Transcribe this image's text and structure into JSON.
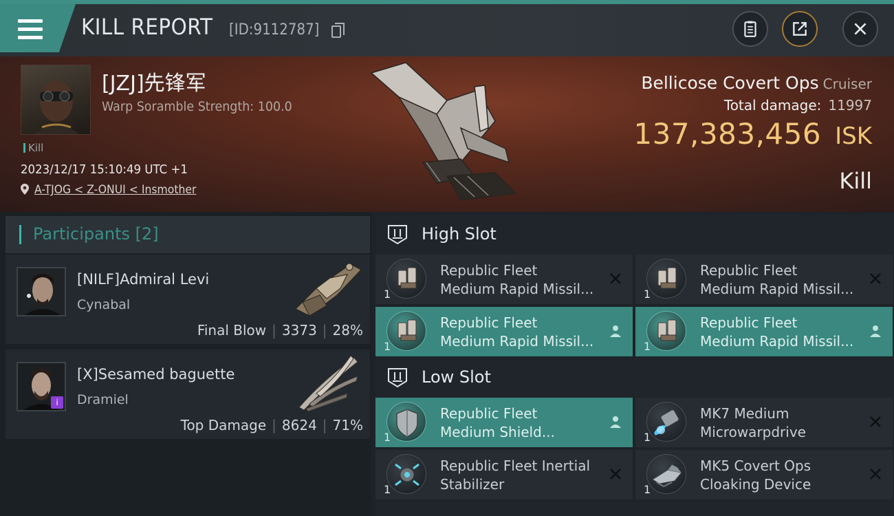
{
  "header": {
    "title": "KILL REPORT",
    "report_id": "[ID:9112787]",
    "buttons": [
      "clipboard-icon",
      "share-icon",
      "close-icon"
    ]
  },
  "victim": {
    "name": "[JZJ]先锋军",
    "warp_text": "Warp Soramble Strength: 100.0",
    "tag": "Kill",
    "timestamp": "2023/12/17 15:10:49 UTC +1",
    "location": "A-TJOG < Z-ONUI < Insmother",
    "ship_name": "Bellicose Covert Ops",
    "ship_class": "Cruiser",
    "damage_label": "Total damage:",
    "damage_value": "11997",
    "isk_amount": "137,383,456",
    "isk_currency": "ISK",
    "kill_type": "Kill"
  },
  "participants": {
    "label": "Participants [2]",
    "rows": [
      {
        "name": "[NILF]Admiral Levi",
        "ship": "Cynabal",
        "role": "Final Blow",
        "damage": "3373",
        "percent": "28%"
      },
      {
        "name": "[X]Sesamed baguette",
        "ship": "Dramiel",
        "role": "Top Damage",
        "damage": "8624",
        "percent": "71%"
      }
    ]
  },
  "slots": {
    "high": {
      "label": "High Slot",
      "modules": [
        {
          "line1": "Republic Fleet",
          "line2": "Medium Rapid Missil...",
          "qty": "1",
          "status": "destroyed"
        },
        {
          "line1": "Republic Fleet",
          "line2": "Medium Rapid Missil...",
          "qty": "1",
          "status": "destroyed"
        },
        {
          "line1": "Republic Fleet",
          "line2": "Medium Rapid Missil...",
          "qty": "1",
          "status": "dropped"
        },
        {
          "line1": "Republic Fleet",
          "line2": "Medium Rapid Missil...",
          "qty": "1",
          "status": "dropped"
        }
      ]
    },
    "low": {
      "label": "Low Slot",
      "modules": [
        {
          "line1": "Republic Fleet",
          "line2": "Medium Shield...",
          "qty": "1",
          "status": "dropped"
        },
        {
          "line1": "MK7 Medium",
          "line2": "Microwarpdrive",
          "qty": "1",
          "status": "destroyed"
        },
        {
          "line1": "Republic Fleet Inertial",
          "line2": "Stabilizer",
          "qty": "1",
          "status": "destroyed"
        },
        {
          "line1": "MK5 Covert Ops",
          "line2": "Cloaking Device",
          "qty": "1",
          "status": "destroyed"
        }
      ]
    }
  },
  "colors": {
    "accent": "#3fb6a8",
    "active_row": "#3a8880",
    "isk_gold": "#f2c77a"
  }
}
